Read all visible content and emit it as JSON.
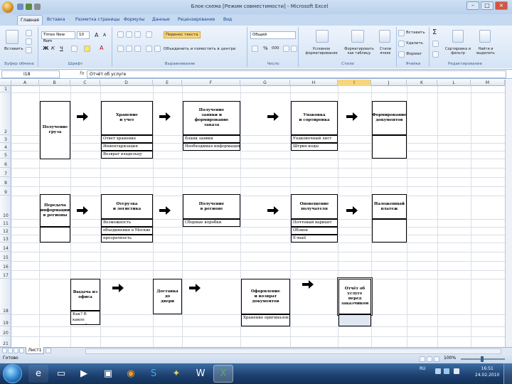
{
  "window": {
    "title": "Блок-схема  [Режим совместимости] - Microsoft Excel",
    "controls": [
      "–",
      "□",
      "×"
    ]
  },
  "ribbon_tabs": [
    "Главная",
    "Вставка",
    "Разметка страницы",
    "Формулы",
    "Данные",
    "Рецензирование",
    "Вид"
  ],
  "active_tab": "Главная",
  "ribbon": {
    "clipboard": {
      "paste": "Вставить",
      "label": "Буфер обмена"
    },
    "font": {
      "name": "Times New Rom",
      "size": "10",
      "bold": "Ж",
      "italic": "К",
      "underline": "Ч",
      "increase": "A",
      "decrease": "A",
      "color_letter": "A",
      "label": "Шрифт"
    },
    "alignment": {
      "wrap": "Перенос текста",
      "merge": "Объединить и поместить в центре",
      "label": "Выравнивание"
    },
    "number": {
      "format": "Общий",
      "percent": "%",
      "thousands": "000",
      "label": "Число"
    },
    "styles": {
      "conditional": "Условное форматирование",
      "table": "Форматировать как таблицу",
      "cell_styles": "Стили ячеек",
      "label": "Стили"
    },
    "cells": {
      "insert": "Вставить",
      "delete": "Удалить",
      "format": "Формат",
      "label": "Ячейки"
    },
    "editing": {
      "sum": "Σ",
      "sort": "Сортировка и фильтр",
      "find": "Найти и выделить",
      "label": "Редактирование"
    }
  },
  "formula_bar": {
    "cell_ref": "I18",
    "fx": "fx",
    "value": "Отчёт об услуге"
  },
  "columns": [
    "A",
    "B",
    "C",
    "D",
    "E",
    "F",
    "G",
    "H",
    "I",
    "J",
    "K",
    "L",
    "M"
  ],
  "selected_column": "I",
  "rows": [
    "1",
    "2",
    "3",
    "4",
    "5",
    "6",
    "7",
    "8",
    "9",
    "10",
    "11",
    "12",
    "13",
    "14",
    "15",
    "16",
    "17",
    "18",
    "19",
    "20",
    "21"
  ],
  "flow": {
    "row1": {
      "b": {
        "title": "Получение\nгруза"
      },
      "d": {
        "title": "Хранение\nи учет",
        "items": [
          "Ответ хранение",
          "Инвентаризация",
          "Возврат владельцу"
        ]
      },
      "f": {
        "title": "Получение\nзаявки и\nформирование\nзаказа",
        "items": [
          "Бланк заявки",
          "Необходимая информация"
        ]
      },
      "h": {
        "title": "Упаковка\nи сортировка",
        "items": [
          "Упаковочный лист",
          "Штрих-коды"
        ]
      },
      "j": {
        "title": "Формирование\nдокументов"
      }
    },
    "row2": {
      "b": {
        "title": "Передача\nинформации\nв регионы"
      },
      "d": {
        "title": "Отгрузка\nи логистика",
        "items": [
          "Возможность",
          "объединения в Москве",
          "прозрачность"
        ]
      },
      "f": {
        "title": "Получение\nв регионе",
        "items": [
          "Сборные коробки"
        ]
      },
      "h": {
        "title": "Оповещение\nполучателя",
        "items": [
          "Почтовый вариант",
          "Обзвон",
          "E-mail"
        ]
      },
      "j": {
        "title": "Наложенный\nплатеж"
      }
    },
    "row3": {
      "c": {
        "title": "Выдача из\nофиса",
        "items": [
          "Как? В какое\nвремя?"
        ]
      },
      "e": {
        "title": "Доставка до\nдвери"
      },
      "g": {
        "title": "Оформление\nи возврат\nдокументов",
        "items": [
          "Хранение оригиналов"
        ]
      },
      "i": {
        "title": "Отчёт об\nуслуге\nперед\nзаказчиком"
      }
    }
  },
  "sheet_tab": "Лист1",
  "status": {
    "ready": "Готово",
    "zoom": "100%"
  },
  "tray": {
    "lang": "RU",
    "time": "16:51",
    "date": "24.02.2010"
  },
  "colors": {
    "accent": "#15428b",
    "selection": "#f8d67c",
    "taskbar": "#1d3f6e"
  }
}
